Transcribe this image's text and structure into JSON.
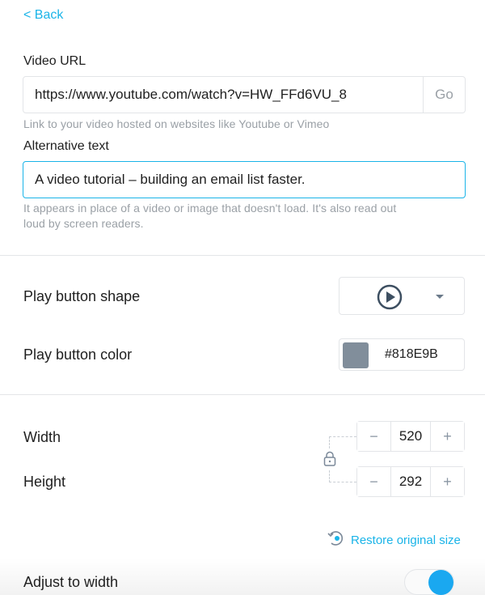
{
  "nav": {
    "back_label": "< Back"
  },
  "video_url": {
    "label": "Video URL",
    "value": "https://www.youtube.com/watch?v=HW_FFd6VU_8",
    "go_label": "Go",
    "hint": "Link to your video hosted on websites like Youtube or Vimeo"
  },
  "alt_text": {
    "label": "Alternative text",
    "value": "A video tutorial – building an email list faster.",
    "hint_line1": "It appears in place of a video or image that doesn't load. It's also read out",
    "hint_line2": "loud by screen readers."
  },
  "play_button": {
    "shape_label": "Play button shape",
    "shape_icon": "play-circle-icon",
    "color_label": "Play button color",
    "color_value": "#818E9B"
  },
  "size": {
    "width_label": "Width",
    "width_value": "520",
    "height_label": "Height",
    "height_value": "292",
    "decrement_symbol": "−",
    "increment_symbol": "+",
    "aspect_locked": true,
    "restore_label": "Restore original size"
  },
  "adjust": {
    "label": "Adjust to width",
    "enabled": true
  },
  "colors": {
    "accent": "#1AB4E8",
    "toggle_on": "#1AA8F0",
    "icon": "#3D4F61"
  }
}
